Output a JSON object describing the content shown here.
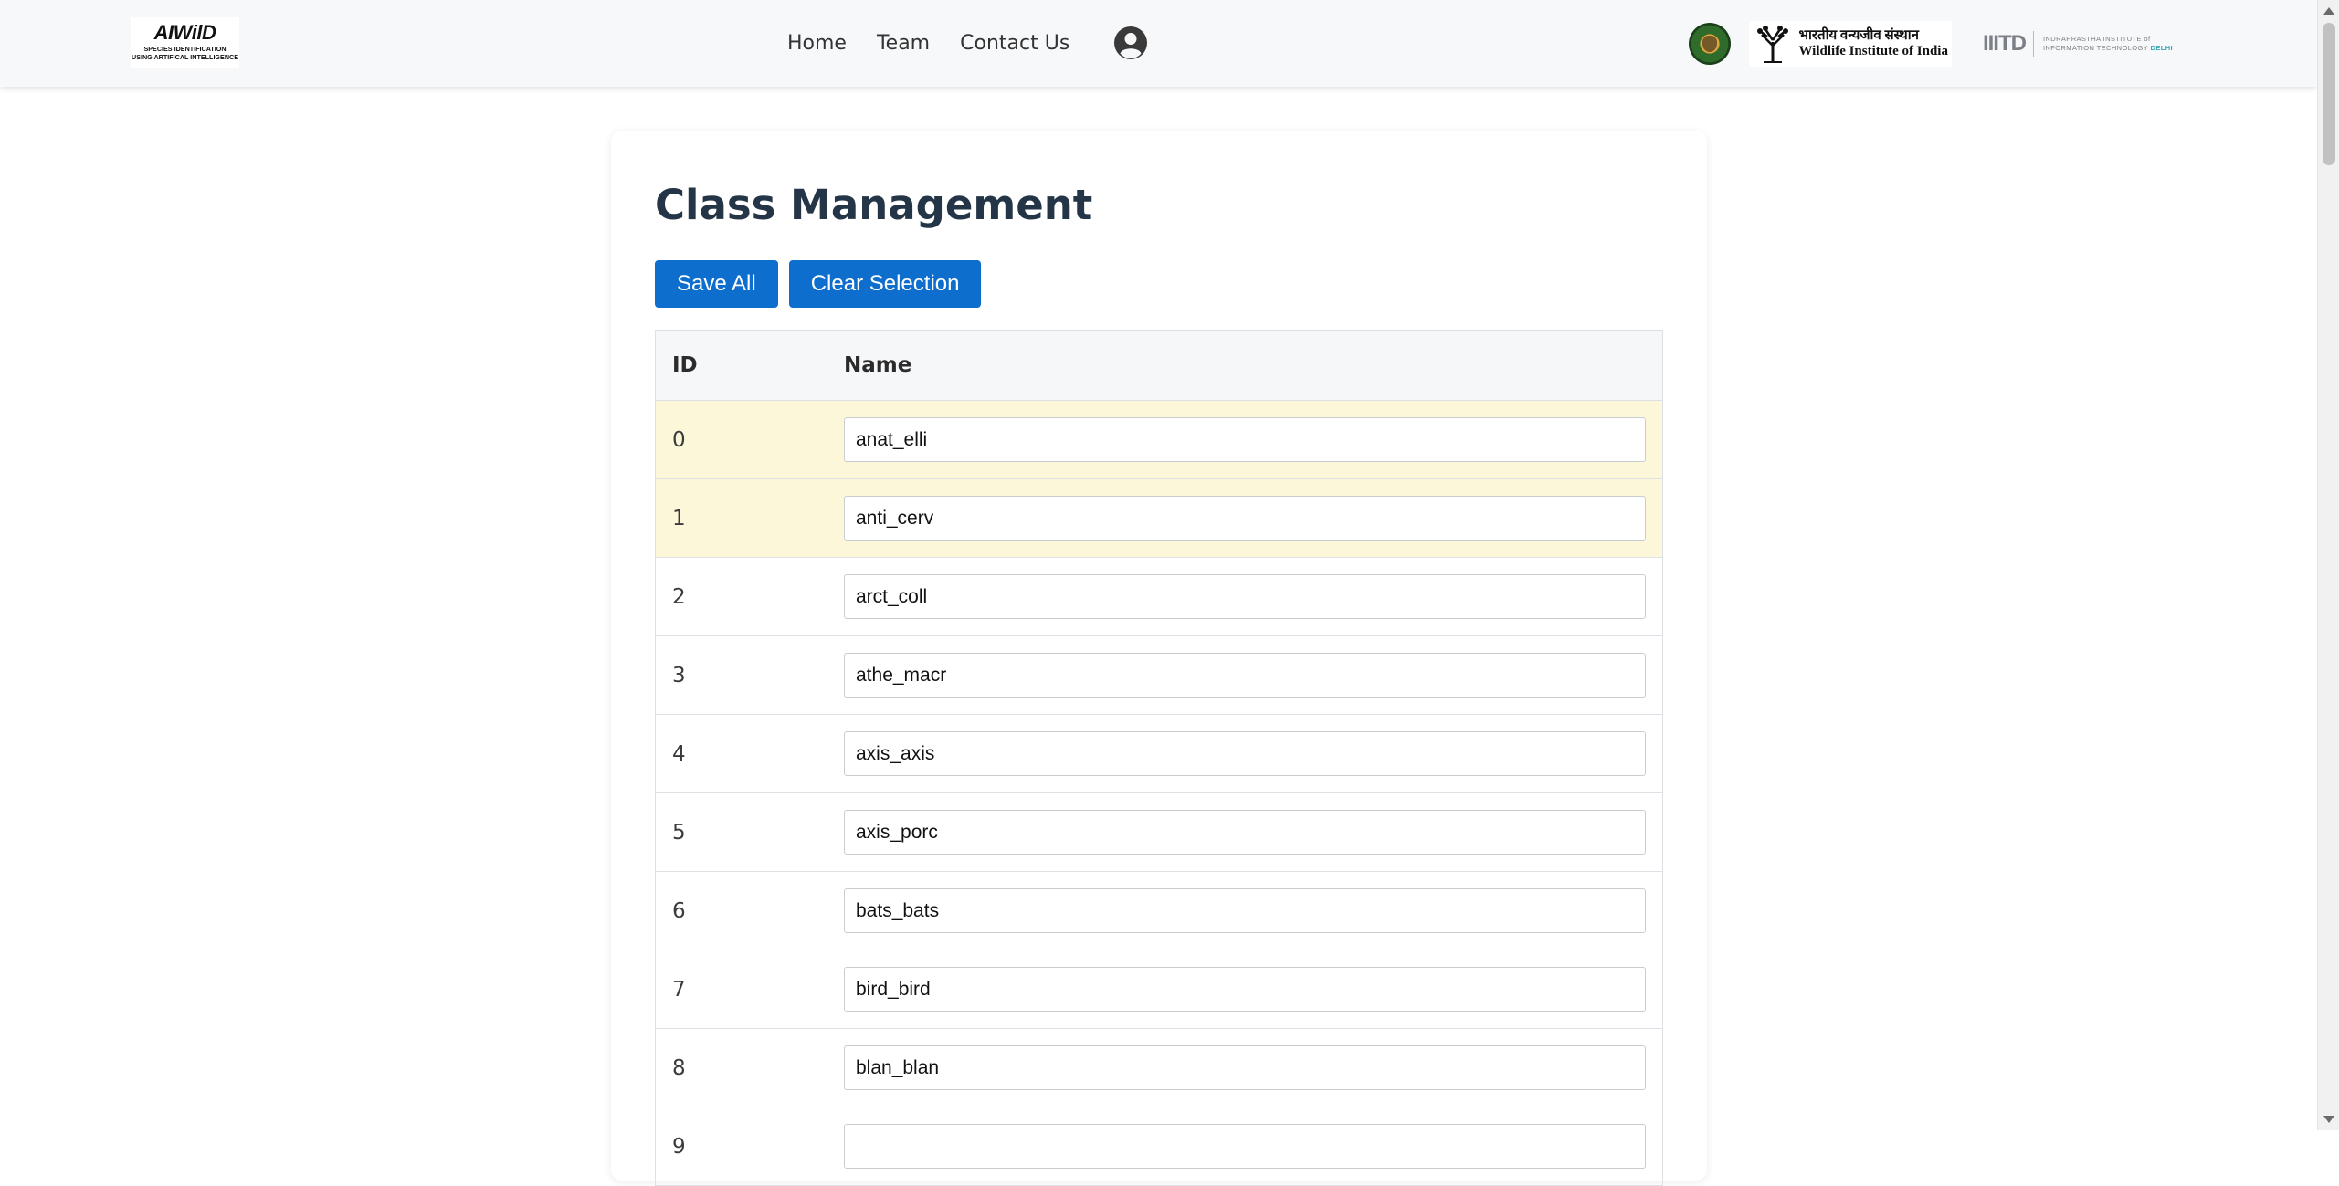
{
  "brand": {
    "name": "AIWilD",
    "tagline": "SPECIES IDENTIFICATION\nUSING ARTIFICAL INTELLIGENCE"
  },
  "nav": {
    "links": [
      "Home",
      "Team",
      "Contact Us"
    ],
    "user_icon": "user-circle-icon"
  },
  "partners": {
    "wii_hindi": "भारतीय वन्यजीव संस्थान",
    "wii_english": "Wildlife Institute of India",
    "iiit_mark": "IIITD",
    "iiit_line1": "INDRAPRASTHA INSTITUTE of",
    "iiit_line2": "INFORMATION TECHNOLOGY",
    "iiit_city": "DELHI"
  },
  "page": {
    "title": "Class Management"
  },
  "toolbar": {
    "save_label": "Save All",
    "clear_label": "Clear Selection"
  },
  "table": {
    "headers": [
      "ID",
      "Name"
    ],
    "rows": [
      {
        "id": "0",
        "name": "anat_elli",
        "selected": true
      },
      {
        "id": "1",
        "name": "anti_cerv",
        "selected": true
      },
      {
        "id": "2",
        "name": "arct_coll",
        "selected": false
      },
      {
        "id": "3",
        "name": "athe_macr",
        "selected": false
      },
      {
        "id": "4",
        "name": "axis_axis",
        "selected": false
      },
      {
        "id": "5",
        "name": "axis_porc",
        "selected": false
      },
      {
        "id": "6",
        "name": "bats_bats",
        "selected": false
      },
      {
        "id": "7",
        "name": "bird_bird",
        "selected": false
      },
      {
        "id": "8",
        "name": "blan_blan",
        "selected": false
      },
      {
        "id": "9",
        "name": "",
        "selected": false
      }
    ]
  },
  "colors": {
    "primary_button": "#0d6ecd",
    "selected_row": "#fdf7da",
    "title": "#233547"
  }
}
